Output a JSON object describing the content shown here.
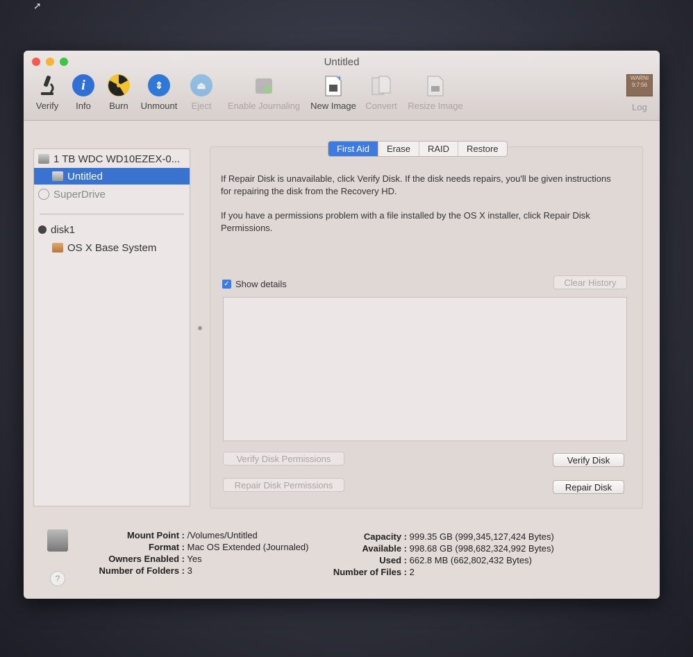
{
  "window": {
    "title": "Untitled"
  },
  "toolbar": {
    "items": [
      {
        "label": "Verify",
        "enabled": true,
        "icon": "microscope-icon"
      },
      {
        "label": "Info",
        "enabled": true,
        "icon": "info-icon"
      },
      {
        "label": "Burn",
        "enabled": true,
        "icon": "burn-icon"
      },
      {
        "label": "Unmount",
        "enabled": true,
        "icon": "unmount-icon"
      },
      {
        "label": "Eject",
        "enabled": false,
        "icon": "eject-icon"
      },
      {
        "label": "Enable Journaling",
        "enabled": false,
        "icon": "journaling-icon"
      },
      {
        "label": "New Image",
        "enabled": true,
        "icon": "new-image-icon"
      },
      {
        "label": "Convert",
        "enabled": false,
        "icon": "convert-icon"
      },
      {
        "label": "Resize Image",
        "enabled": false,
        "icon": "resize-image-icon"
      }
    ],
    "log": {
      "label": "Log",
      "icon_text": "WARNI\n9:7:56"
    }
  },
  "sidebar": {
    "items": [
      {
        "label": "1 TB WDC WD10EZEX-0...",
        "icon": "hard-drive-icon"
      },
      {
        "label": "Untitled",
        "icon": "volume-icon",
        "selected": true
      },
      {
        "label": "SuperDrive",
        "icon": "optical-drive-icon"
      },
      {
        "label": "disk1",
        "icon": "disk-image-icon"
      },
      {
        "label": "OS X Base System",
        "icon": "volume-icon"
      }
    ]
  },
  "tabs": [
    "First Aid",
    "Erase",
    "RAID",
    "Restore"
  ],
  "first_aid": {
    "para1": "If Repair Disk is unavailable, click Verify Disk. If the disk needs repairs, you'll be given instructions for repairing the disk from the Recovery HD.",
    "para2": "If you have a permissions problem with a file installed by the OS X installer, click Repair Disk Permissions.",
    "show_details": "Show details",
    "show_details_checked": true,
    "clear_history": "Clear History",
    "verify_permissions": "Verify Disk Permissions",
    "repair_permissions": "Repair Disk Permissions",
    "verify_disk": "Verify Disk",
    "repair_disk": "Repair Disk"
  },
  "info": {
    "mount_point_label": "Mount Point :",
    "mount_point": "/Volumes/Untitled",
    "format_label": "Format :",
    "format": "Mac OS Extended (Journaled)",
    "owners_label": "Owners Enabled :",
    "owners": "Yes",
    "folders_label": "Number of Folders :",
    "folders": "3",
    "capacity_label": "Capacity :",
    "capacity": "999.35 GB (999,345,127,424 Bytes)",
    "available_label": "Available :",
    "available": "998.68 GB (998,682,324,992 Bytes)",
    "used_label": "Used :",
    "used": "662.8 MB (662,802,432 Bytes)",
    "files_label": "Number of Files :",
    "files": "2"
  },
  "help": "?"
}
